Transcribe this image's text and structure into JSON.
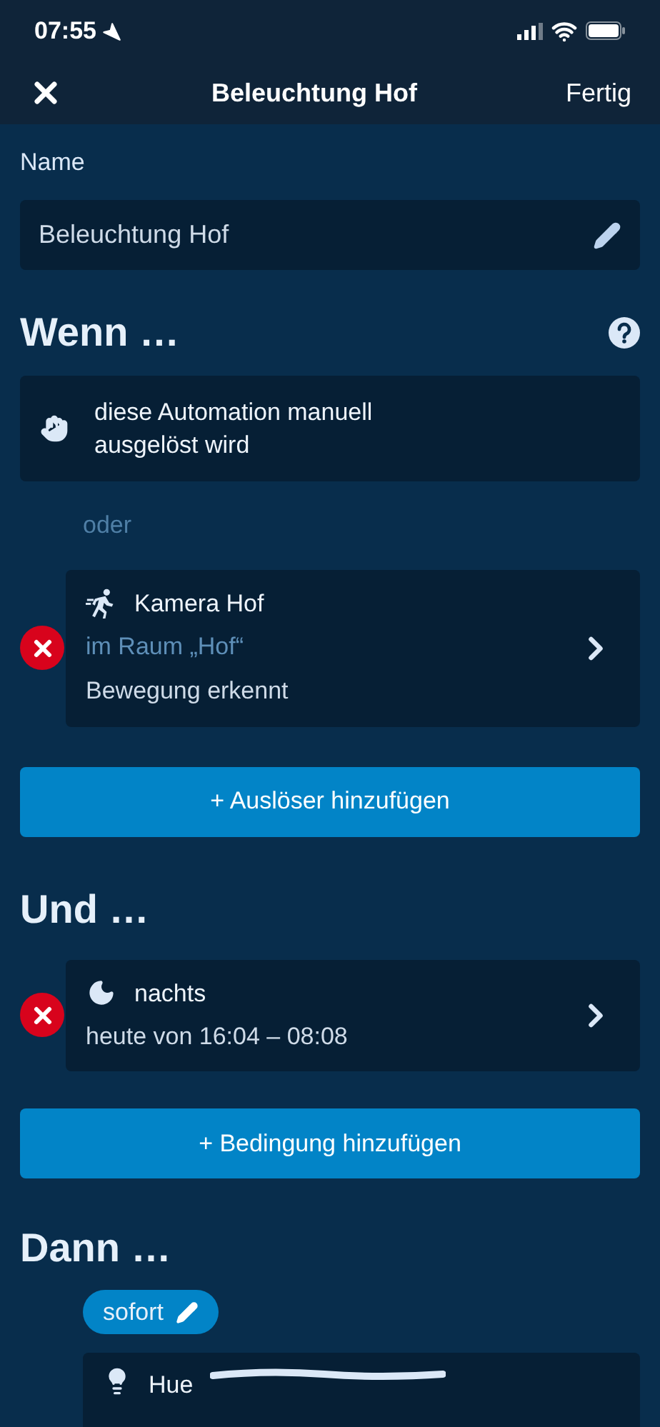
{
  "status_bar": {
    "time": "07:55"
  },
  "header": {
    "title": "Beleuchtung Hof",
    "done": "Fertig"
  },
  "name_field": {
    "label": "Name",
    "value": "Beleuchtung Hof"
  },
  "when": {
    "title": "Wenn …",
    "triggers": [
      {
        "kind": "manual",
        "removable": false,
        "title": "diese Automation manuell ausgelöst wird"
      },
      {
        "kind": "motion",
        "removable": true,
        "title": "Kamera Hof",
        "room": "im Raum „Hof“",
        "detail": "Bewegung erkennt"
      }
    ],
    "separator": "oder",
    "add_button": "+ Auslöser hinzufügen"
  },
  "and": {
    "title": "Und …",
    "conditions": [
      {
        "kind": "night",
        "removable": true,
        "title": "nachts",
        "detail": "heute von 16:04 – 08:08"
      }
    ],
    "add_button": "+ Bedingung hinzufügen"
  },
  "then": {
    "title": "Dann …",
    "timing": "sofort",
    "actions": [
      {
        "kind": "light",
        "title": "Hue"
      }
    ]
  }
}
